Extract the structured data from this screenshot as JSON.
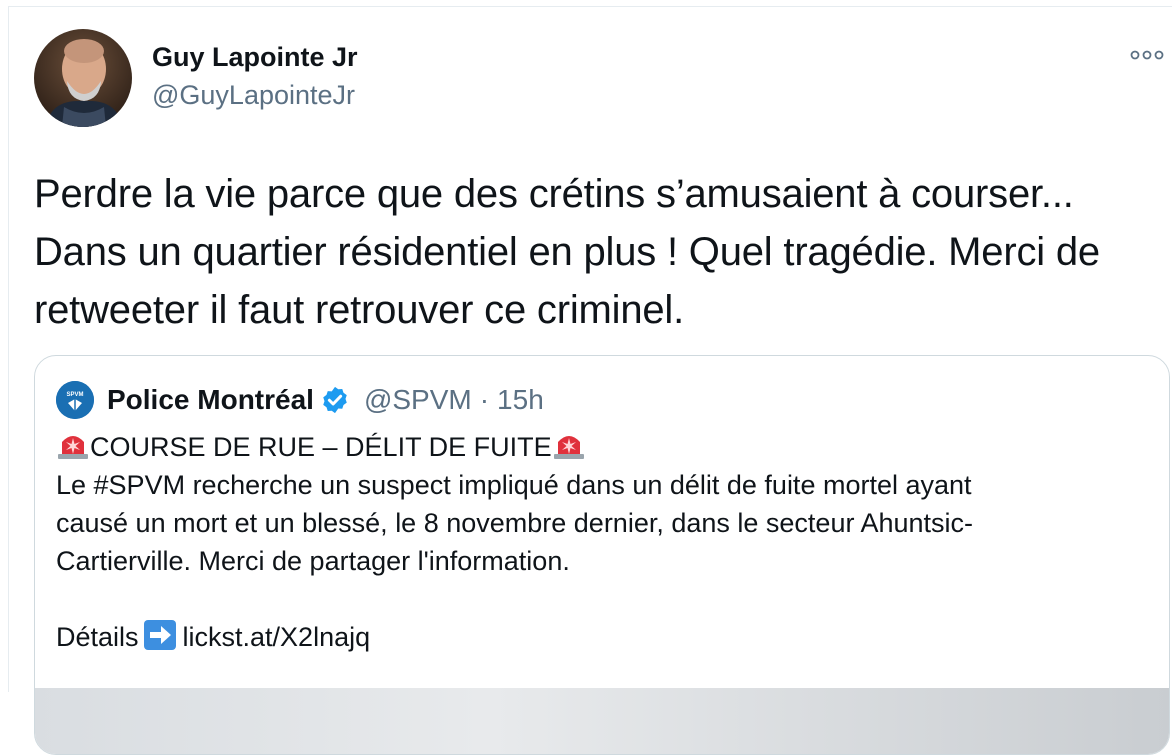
{
  "author": {
    "name": "Guy Lapointe Jr",
    "handle": "@GuyLapointeJr",
    "avatar_icon": "profile-photo"
  },
  "more_icon": "more-options-icon",
  "tweet_text": "Perdre la vie parce que des crétins s’amusaient à courser... Dans un quartier résidentiel en plus ! Quel tragédie. Merci de retweeter il faut retrouver ce criminel.",
  "quoted": {
    "name": "Police Montréal",
    "verified": true,
    "handle": "@SPVM",
    "separator": "·",
    "time": "15h",
    "logo_text": "SPVM",
    "headline": "COURSE DE RUE – DÉLIT DE FUITE",
    "body_lines": [
      "Le #SPVM recherche un suspect impliqué dans un délit de fuite mortel ayant",
      "causé un mort et un blessé, le 8 novembre dernier, dans le secteur Ahuntsic-",
      "Cartierville. Merci de partager l'information."
    ],
    "details_label": "Détails",
    "link_text": "lickst.at/X2lnajq"
  },
  "colors": {
    "text_primary": "#0f1419",
    "text_secondary": "#5b7083",
    "verified_blue": "#1d9bf0",
    "border": "#cfd9de"
  }
}
